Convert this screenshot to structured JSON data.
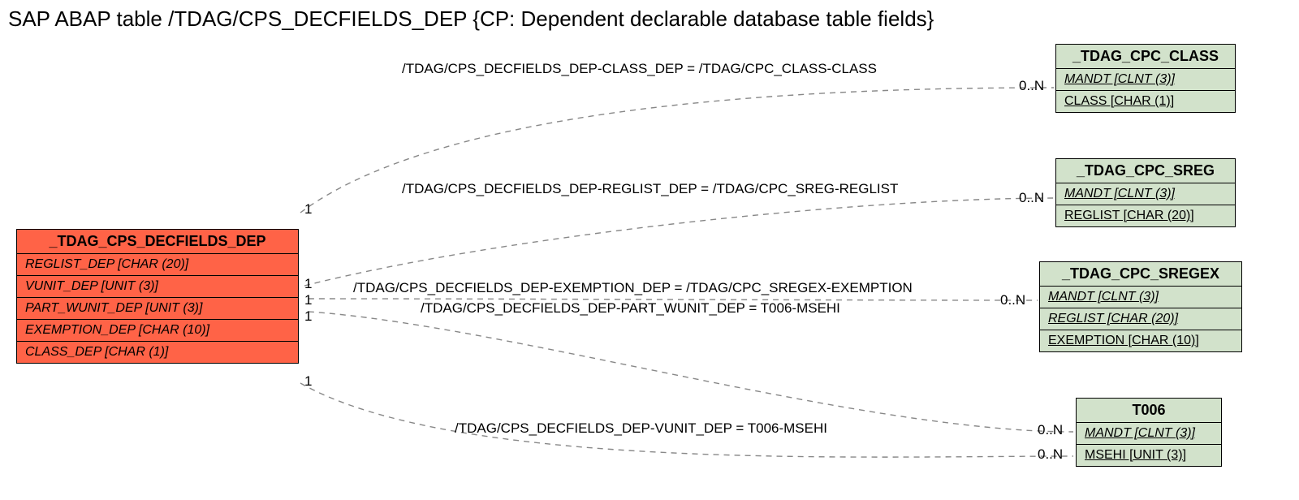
{
  "title": "SAP ABAP table /TDAG/CPS_DECFIELDS_DEP {CP: Dependent declarable database table fields}",
  "main_entity": {
    "name": "_TDAG_CPS_DECFIELDS_DEP",
    "fields": [
      "REGLIST_DEP [CHAR (20)]",
      "VUNIT_DEP [UNIT (3)]",
      "PART_WUNIT_DEP [UNIT (3)]",
      "EXEMPTION_DEP [CHAR (10)]",
      "CLASS_DEP [CHAR (1)]"
    ]
  },
  "refs": {
    "class": {
      "name": "_TDAG_CPC_CLASS",
      "fields": [
        "MANDT [CLNT (3)]",
        "CLASS [CHAR (1)]"
      ]
    },
    "sreg": {
      "name": "_TDAG_CPC_SREG",
      "fields": [
        "MANDT [CLNT (3)]",
        "REGLIST [CHAR (20)]"
      ]
    },
    "sregex": {
      "name": "_TDAG_CPC_SREGEX",
      "fields": [
        "MANDT [CLNT (3)]",
        "REGLIST [CHAR (20)]",
        "EXEMPTION [CHAR (10)]"
      ]
    },
    "t006": {
      "name": "T006",
      "fields": [
        "MANDT [CLNT (3)]",
        "MSEHI [UNIT (3)]"
      ]
    }
  },
  "relations": {
    "r1": "/TDAG/CPS_DECFIELDS_DEP-CLASS_DEP = /TDAG/CPC_CLASS-CLASS",
    "r2": "/TDAG/CPS_DECFIELDS_DEP-REGLIST_DEP = /TDAG/CPC_SREG-REGLIST",
    "r3": "/TDAG/CPS_DECFIELDS_DEP-EXEMPTION_DEP = /TDAG/CPC_SREGEX-EXEMPTION",
    "r4": "/TDAG/CPS_DECFIELDS_DEP-PART_WUNIT_DEP = T006-MSEHI",
    "r5": "/TDAG/CPS_DECFIELDS_DEP-VUNIT_DEP = T006-MSEHI"
  },
  "card": {
    "one": "1",
    "many": "0..N"
  }
}
